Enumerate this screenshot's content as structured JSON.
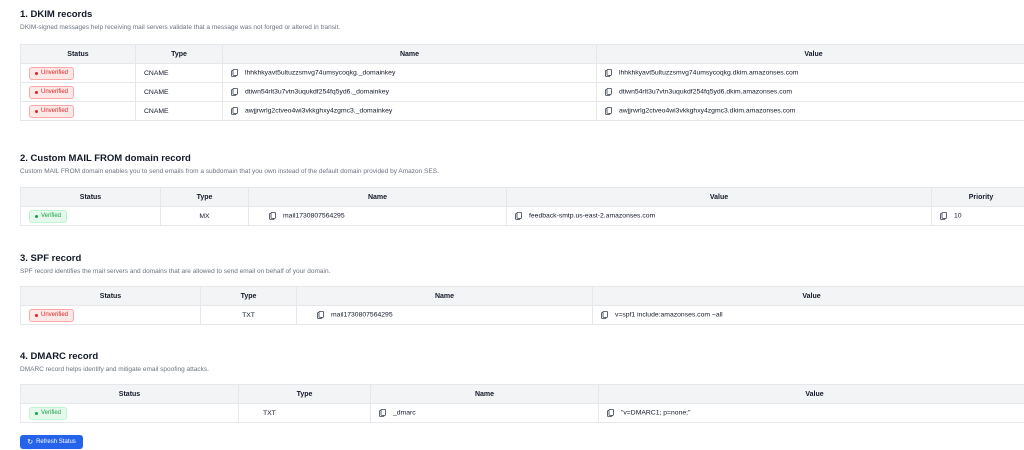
{
  "dkim": {
    "title": "1. DKIM records",
    "description": "DKIM-signed messages help receiving mail servers validate that a message was not forged or altered in transit.",
    "headers": [
      "Status",
      "Type",
      "Name",
      "Value"
    ],
    "rows": [
      {
        "status": "Unverified",
        "type": "CNAME",
        "name": "lhhkhkyavt5ultuzzsmvg74umsycoqkg._domainkey",
        "value": "lhhkhkyavt5ultuzzsmvg74umsycoqkg.dkim.amazonses.com"
      },
      {
        "status": "Unverified",
        "type": "CNAME",
        "name": "dtiwn54rlt3u7vtn3uqukdf254fq5yd6._domainkey",
        "value": "dtiwn54rlt3u7vtn3uqukdf254fq5yd6.dkim.amazonses.com"
      },
      {
        "status": "Unverified",
        "type": "CNAME",
        "name": "awjjrwrlg2ctveo4wi3vkkghxy4zgmc3._domainkey",
        "value": "awjjrwrlg2ctveo4wi3vkkghxy4zgmc3.dkim.amazonses.com"
      }
    ]
  },
  "mailfrom": {
    "title": "2. Custom MAIL FROM domain record",
    "description": "Custom MAIL FROM domain enables you to send emails from a subdomain that you own instead of the default domain provided by Amazon SES.",
    "headers": [
      "Status",
      "Type",
      "Name",
      "Value",
      "Priority"
    ],
    "rows": [
      {
        "status": "Verified",
        "type": "MX",
        "name": "mail1730807564295",
        "value": "feedback-smtp.us-east-2.amazonses.com",
        "priority": "10"
      }
    ]
  },
  "spf": {
    "title": "3. SPF record",
    "description": "SPF record identifies the mail servers and domains that are allowed to send email on behalf of your domain.",
    "headers": [
      "Status",
      "Type",
      "Name",
      "Value"
    ],
    "rows": [
      {
        "status": "Unverified",
        "type": "TXT",
        "name": "mail1730807564295",
        "value": "v=spf1 include:amazonses.com ~all"
      }
    ]
  },
  "dmarc": {
    "title": "4. DMARC record",
    "description": "DMARC record helps identify and mitigate email spoofing attacks.",
    "headers": [
      "Status",
      "Type",
      "Name",
      "Value"
    ],
    "rows": [
      {
        "status": "Verified",
        "type": "TXT",
        "name": "_dmarc",
        "value": "\"v=DMARC1; p=none;\""
      }
    ]
  },
  "refresh_button": {
    "label": "Refresh Status",
    "icon": "refresh-icon"
  },
  "colors": {
    "accent": "#2563eb",
    "unverified": "#dc2626",
    "verified": "#16a34a",
    "header_bg": "#f3f4f6"
  }
}
